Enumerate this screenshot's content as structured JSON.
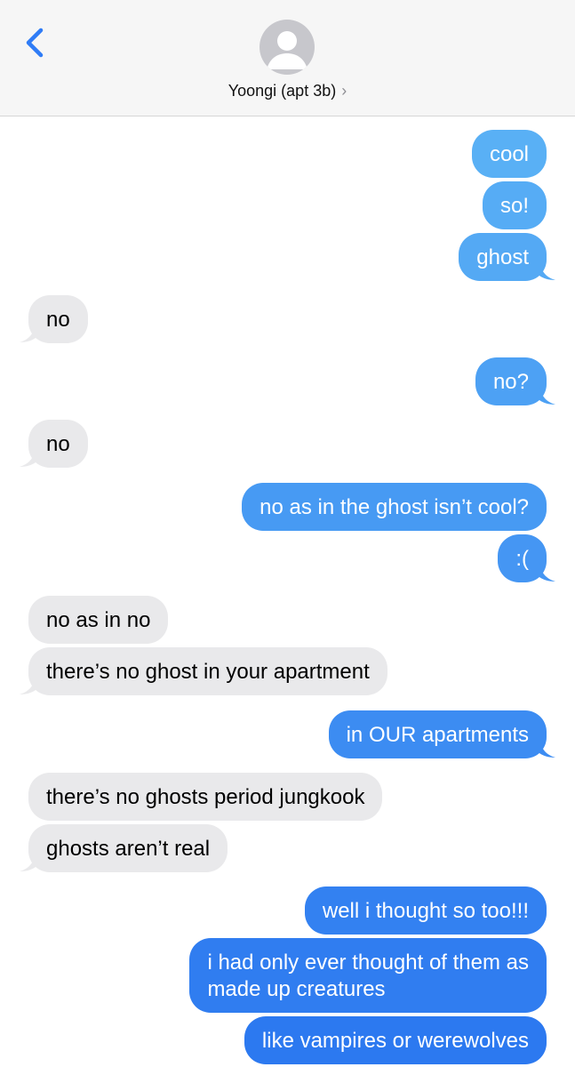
{
  "header": {
    "contact_name": "Yoongi (apt 3b)",
    "back_icon": "chevron-left-icon",
    "avatar_icon": "person-silhouette-icon",
    "disclosure_icon": "chevron-right-icon",
    "colors": {
      "accent": "#2f7cf6",
      "header_bg": "#f6f6f6"
    }
  },
  "colors": {
    "sent_top": "#5ab1f5",
    "sent_bottom": "#2b77f0",
    "received": "#e9e9eb"
  },
  "messages": [
    {
      "from": "me",
      "text": "cool"
    },
    {
      "from": "me",
      "text": "so!"
    },
    {
      "from": "me",
      "text": "ghost"
    },
    {
      "from": "them",
      "text": "no"
    },
    {
      "from": "me",
      "text": "no?"
    },
    {
      "from": "them",
      "text": "no"
    },
    {
      "from": "me",
      "text": "no as in the ghost isn’t cool?"
    },
    {
      "from": "me",
      "text": ":("
    },
    {
      "from": "them",
      "text": "no as in no"
    },
    {
      "from": "them",
      "text": "there’s no ghost in your apartment"
    },
    {
      "from": "me",
      "text": "in OUR apartments"
    },
    {
      "from": "them",
      "text": "there’s no ghosts period jungkook"
    },
    {
      "from": "them",
      "text": "ghosts aren’t real"
    },
    {
      "from": "me",
      "text": "well i thought so too!!!"
    },
    {
      "from": "me",
      "text": "i had only ever thought of them as\nmade up creatures"
    },
    {
      "from": "me",
      "text": "like vampires or werewolves"
    }
  ]
}
